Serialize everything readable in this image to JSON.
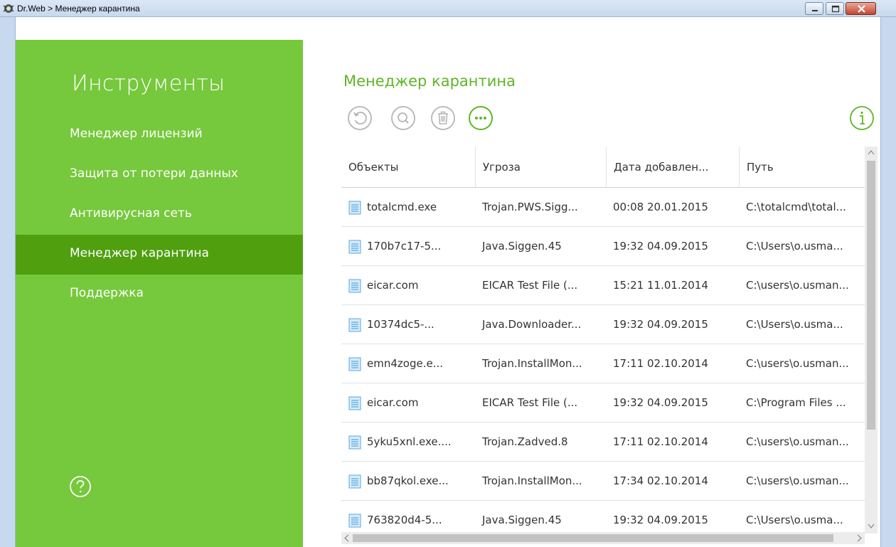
{
  "window": {
    "title": "Dr.Web > Менеджер карантина"
  },
  "sidebar": {
    "title": "Инструменты",
    "items": [
      {
        "label": "Менеджер лицензий",
        "active": false
      },
      {
        "label": "Защита от потери данных",
        "active": false
      },
      {
        "label": "Антивирусная сеть",
        "active": false
      },
      {
        "label": "Менеджер карантина",
        "active": true
      },
      {
        "label": "Поддержка",
        "active": false
      }
    ],
    "help_icon": "question-circle-icon"
  },
  "main": {
    "title": "Менеджер карантина",
    "toolbar": {
      "restore_icon": "restore-icon",
      "scan_icon": "search-icon",
      "delete_icon": "trash-icon",
      "more_icon": "more-icon",
      "info_icon": "info-icon"
    },
    "table": {
      "columns": [
        "Объекты",
        "Угроза",
        "Дата добавлен...",
        "Путь"
      ],
      "rows": [
        [
          "totalcmd.exe",
          "Trojan.PWS.Sigg...",
          "00:08 20.01.2015",
          "C:\\totalcmd\\total..."
        ],
        [
          "170b7c17-5...",
          "Java.Siggen.45",
          "19:32 04.09.2015",
          "C:\\Users\\o.usma..."
        ],
        [
          "eicar.com",
          "EICAR Test File (...",
          "15:21 11.01.2014",
          "C:\\users\\o.usman..."
        ],
        [
          "10374dc5-...",
          "Java.Downloader...",
          "19:32 04.09.2015",
          "C:\\Users\\o.usma..."
        ],
        [
          "emn4zoge.e...",
          "Trojan.InstallMon...",
          "17:11 02.10.2014",
          "C:\\users\\o.usman..."
        ],
        [
          "eicar.com",
          "EICAR Test File (...",
          "19:32 04.09.2015",
          "C:\\Program Files ..."
        ],
        [
          "5yku5xnl.exe....",
          "Trojan.Zadved.8",
          "17:11 02.10.2014",
          "C:\\users\\o.usman..."
        ],
        [
          "bb87qkol.exe...",
          "Trojan.InstallMon...",
          "17:34 02.10.2014",
          "C:\\users\\o.usman..."
        ],
        [
          "763820d4-5...",
          "Java.Siggen.45",
          "19:32 04.09.2015",
          "C:\\Users\\o.usma..."
        ]
      ]
    }
  },
  "colors": {
    "sidebar": "#76c83c",
    "sidebar_active": "#4f9f0f",
    "accent": "#5fb526",
    "icon_disabled": "#b5b5b5"
  }
}
